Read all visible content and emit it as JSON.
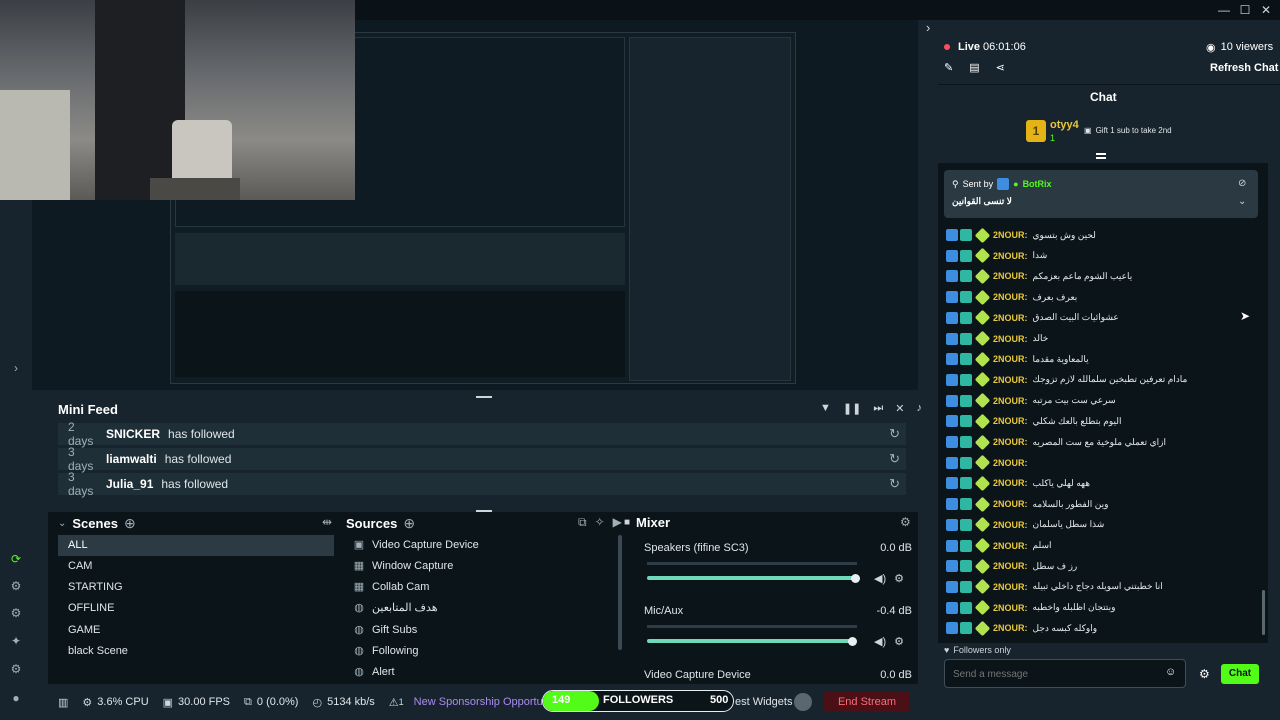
{
  "window": {
    "minimize": "—",
    "maximize": "☐",
    "close": "✕"
  },
  "mini_feed": {
    "title": "Mini Feed",
    "rows": [
      {
        "age": "2 days",
        "user": "SNICKER",
        "action": "has followed"
      },
      {
        "age": "3 days",
        "user": "liamwalti",
        "action": "has followed"
      },
      {
        "age": "3 days",
        "user": "Julia_91",
        "action": "has followed"
      }
    ]
  },
  "scenes": {
    "title": "Scenes",
    "items": [
      "ALL",
      "CAM",
      "STARTING",
      "OFFLINE",
      "GAME",
      "black Scene"
    ]
  },
  "sources": {
    "title": "Sources",
    "items": [
      "Video Capture Device",
      "Window Capture",
      "Collab Cam",
      "هدف المتابعين",
      "Gift Subs",
      "Following",
      "Alert"
    ]
  },
  "mixer": {
    "title": "Mixer",
    "channels": [
      {
        "name": "Speakers (fifine SC3)",
        "value": "0.0 dB"
      },
      {
        "name": "Mic/Aux",
        "value": "-0.4 dB"
      },
      {
        "name": "Video Capture Device",
        "value": "0.0 dB"
      }
    ]
  },
  "footer": {
    "cpu": "3.6% CPU",
    "fps": "30.00 FPS",
    "dropped": "0 (0.0%)",
    "bitrate": "5134 kb/s",
    "alert_count": "1",
    "sponsorship": "New Sponsorship Opportunity with He",
    "followers_count": "149",
    "followers_label": "FOLLOWERS",
    "followers_goal": "500",
    "test_widgets": "est Widgets",
    "end_stream": "End Stream"
  },
  "chat": {
    "live_label": "Live",
    "live_time": "06:01:06",
    "viewers": "10 viewers",
    "refresh": "Refresh Chat",
    "title": "Chat",
    "gift_user": "otyy4",
    "gift_count": "1",
    "gift_text": "Gift 1 sub to take 2nd",
    "pinned_sent_by": "Sent by",
    "pinned_bot": "BotRix",
    "pinned_message": "لا تنسى القوانين",
    "username": "2NOUR:",
    "messages": [
      "لحين وش بتسوي",
      "شدا",
      "ياعيب الشوم ماعم بعزمكم",
      "بعرف بعرف",
      "عشوائيات البيت الصدق",
      "خالد",
      "يالمعاوية مقدما",
      "مادام تعرفين تطبخين سلمالله لازم تزوجك",
      "سرعي ست بيت مرتبه",
      "اليوم بتطلع بالعك شكلي",
      "ازاي تعملي ملوخية مع ست المصريه",
      "",
      "ههه لهلي ياكلب",
      "وين الفطور بالسلامه",
      "شذا سطل ياسلمان",
      "اسلم",
      "رز ف سطل",
      "انا خطبتني اسويله دجاج داخلي تبيله",
      "وبتتجان اظلبله واخطبه",
      "واوكله كبسه دجل"
    ],
    "followers_only": "Followers only",
    "input_placeholder": "Send a message",
    "send_label": "Chat"
  }
}
